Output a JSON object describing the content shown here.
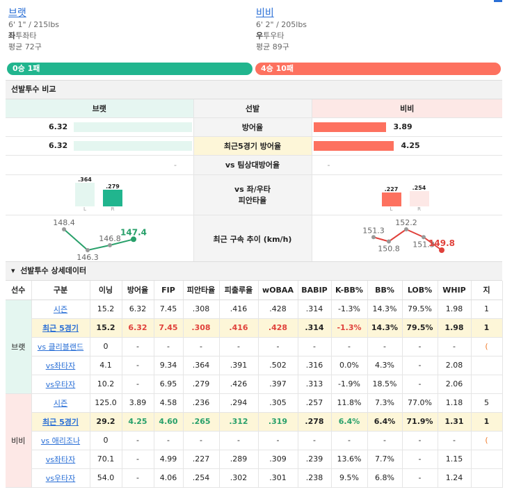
{
  "colors": {
    "left": "#21b58e",
    "left_light": "#e4f6f0",
    "right": "#fd715f",
    "right_light": "#fde8e6",
    "highlight": "#fdf6d8",
    "link": "#2a6fd6"
  },
  "left_pitcher": {
    "name": "브랫",
    "height_weight": "6' 1\" / 215lbs",
    "throws_prefix": "좌",
    "throws_suffix": "투좌타",
    "avg_pitches": "평균 72구",
    "record": "0승 1패"
  },
  "right_pitcher": {
    "name": "비비",
    "height_weight": "6' 2\" / 205lbs",
    "throws_prefix": "우",
    "throws_suffix": "투우타",
    "avg_pitches": "평균 89구",
    "record": "4승 10패"
  },
  "comparison": {
    "title": "선발투수 비교",
    "header_mid": "선발",
    "era": {
      "label": "방어율",
      "left": "6.32",
      "right": "3.89"
    },
    "recent_era": {
      "label": "최근5경기 방어율",
      "left": "6.32",
      "right": "4.25"
    },
    "vs_team": {
      "label": "vs 팀상대방어율",
      "left": "-",
      "right": "-"
    },
    "vs_hand": {
      "label_line1": "vs 좌/우타",
      "label_line2": "피안타율",
      "left": {
        "L": ".364",
        "R": ".279"
      },
      "right": {
        "L": ".227",
        "R": ".254"
      },
      "L_label": "L",
      "R_label": "R"
    },
    "velocity": {
      "label": "최근 구속 추이 (km/h)",
      "left": [
        "148.4",
        "146.3",
        "146.8",
        "147.4"
      ],
      "right": [
        "151.3",
        "150.8",
        "152.2",
        "151.3",
        "149.8"
      ]
    }
  },
  "detail": {
    "title": "선발투수 상세데이터",
    "headers": [
      "선수",
      "구분",
      "이닝",
      "방어율",
      "FIP",
      "피안타율",
      "피출루율",
      "wOBAA",
      "BABIP",
      "K-BB%",
      "BB%",
      "LOB%",
      "WHIP",
      "지"
    ],
    "players": [
      {
        "name": "브랫",
        "rows": [
          {
            "label": "시즌",
            "cells": [
              "15.2",
              "6.32",
              "7.45",
              ".308",
              ".416",
              ".428",
              ".314",
              "-1.3%",
              "14.3%",
              "79.5%",
              "1.98",
              "1"
            ]
          },
          {
            "label": "최근 5경기",
            "cells": [
              "15.2",
              "6.32",
              "7.45",
              ".308",
              ".416",
              ".428",
              ".314",
              "-1.3%",
              "14.3%",
              "79.5%",
              "1.98",
              "1"
            ]
          },
          {
            "label": "vs 클리블랜드",
            "cells": [
              "0",
              "-",
              "-",
              "-",
              "-",
              "-",
              "-",
              "-",
              "-",
              "-",
              "-",
              "("
            ]
          },
          {
            "label": "vs좌타자",
            "cells": [
              "4.1",
              "-",
              "9.34",
              ".364",
              ".391",
              ".502",
              ".316",
              "0.0%",
              "4.3%",
              "-",
              "2.08",
              ""
            ]
          },
          {
            "label": "vs우타자",
            "cells": [
              "10.2",
              "-",
              "6.95",
              ".279",
              ".426",
              ".397",
              ".313",
              "-1.9%",
              "18.5%",
              "-",
              "2.06",
              ""
            ]
          }
        ]
      },
      {
        "name": "비비",
        "rows": [
          {
            "label": "시즌",
            "cells": [
              "125.0",
              "3.89",
              "4.58",
              ".236",
              ".294",
              ".305",
              ".257",
              "11.8%",
              "7.3%",
              "77.0%",
              "1.18",
              "5"
            ]
          },
          {
            "label": "최근 5경기",
            "cells": [
              "29.2",
              "4.25",
              "4.60",
              ".265",
              ".312",
              ".319",
              ".278",
              "6.4%",
              "6.4%",
              "71.9%",
              "1.31",
              "1"
            ]
          },
          {
            "label": "vs 애리조나",
            "cells": [
              "0",
              "-",
              "-",
              "-",
              "-",
              "-",
              "-",
              "-",
              "-",
              "-",
              "-",
              "("
            ]
          },
          {
            "label": "vs좌타자",
            "cells": [
              "70.1",
              "-",
              "4.99",
              ".227",
              ".289",
              ".309",
              ".239",
              "13.6%",
              "7.7%",
              "-",
              "1.15",
              ""
            ]
          },
          {
            "label": "vs우타자",
            "cells": [
              "54.0",
              "-",
              "4.06",
              ".254",
              ".302",
              ".301",
              ".238",
              "9.5%",
              "6.8%",
              "-",
              "1.24",
              ""
            ]
          }
        ]
      }
    ]
  }
}
